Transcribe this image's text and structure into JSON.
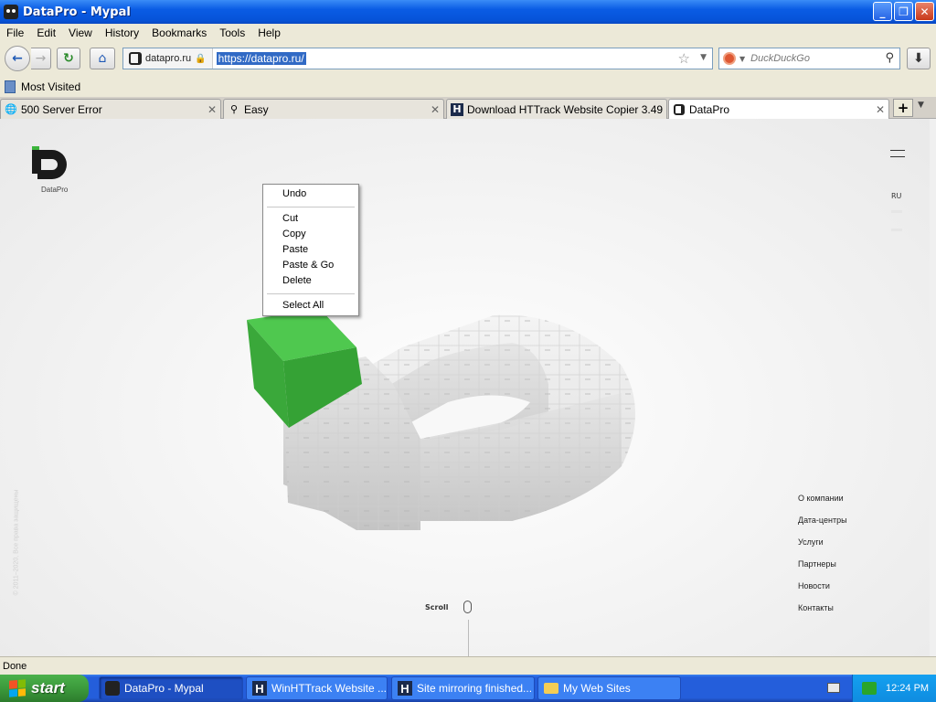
{
  "window": {
    "title": "DataPro - Mypal"
  },
  "menubar": {
    "items": [
      "File",
      "Edit",
      "View",
      "History",
      "Bookmarks",
      "Tools",
      "Help"
    ]
  },
  "navbar": {
    "site_domain": "datapro.ru",
    "url": "https://datapro.ru/",
    "search_placeholder": "DuckDuckGo"
  },
  "bookmarks": {
    "most_visited": "Most Visited"
  },
  "tabs": [
    {
      "label": "500 Server Error",
      "icon": "globe-icon"
    },
    {
      "label": "Easy",
      "icon": "magnifier-icon"
    },
    {
      "label": "Download HTTrack Website Copier 3.49...",
      "icon": "httrack-icon"
    },
    {
      "label": "DataPro",
      "icon": "datapro-icon"
    }
  ],
  "context_menu": {
    "items": [
      "Undo",
      "Cut",
      "Copy",
      "Paste",
      "Paste & Go",
      "Delete",
      "Select All"
    ]
  },
  "page": {
    "logo_label": "DataPro",
    "lang": "RU",
    "nav": [
      "О компании",
      "Дата-центры",
      "Услуги",
      "Партнеры",
      "Новости",
      "Контакты"
    ],
    "scroll_label": "Scroll",
    "copyright": "© 2011–2020, Все права защищены"
  },
  "status": {
    "text": "Done"
  },
  "taskbar": {
    "start_label": "start",
    "tasks": [
      "DataPro - Mypal",
      "WinHTTrack Website ...",
      "Site mirroring finished...",
      "My Web Sites"
    ],
    "clock": "12:24 PM"
  },
  "colors": {
    "accent_green": "#3db53d",
    "selection_blue": "#316ac5",
    "xp_blue": "#245edb"
  }
}
